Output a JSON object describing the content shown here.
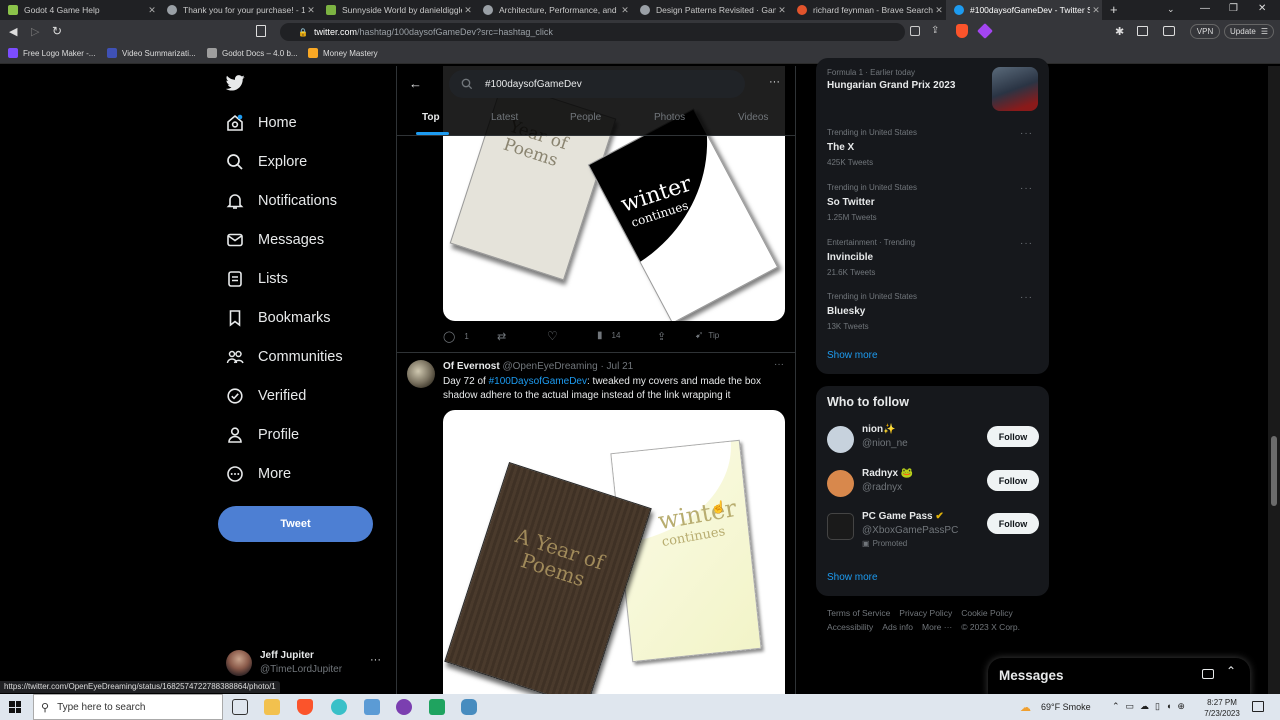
{
  "browser": {
    "tabs": [
      {
        "title": "Godot 4 Game Help",
        "color": "#8bc34a"
      },
      {
        "title": "Thank you for your purchase! - 1st Ph",
        "color": "#9aa0a6"
      },
      {
        "title": "Sunnyside World by danieldiggle",
        "color": "#7cb342"
      },
      {
        "title": "Architecture, Performance, and Game",
        "color": "#9aa0a6"
      },
      {
        "title": "Design Patterns Revisited · Game Pro",
        "color": "#9aa0a6"
      },
      {
        "title": "richard feynman - Brave Search",
        "color": "#e2542c"
      },
      {
        "title": "#100daysofGameDev - Twitter Se",
        "color": "#1d9bf0"
      }
    ],
    "url_host": "twitter.com",
    "url_path": "/hashtag/100daysofGameDev?src=hashtag_click",
    "vpn_label": "VPN",
    "update_label": "Update",
    "bookmarks": [
      {
        "label": "Free Logo Maker -...",
        "color": "#7c4dff"
      },
      {
        "label": "Video Summarizati...",
        "color": "#3f51b5"
      },
      {
        "label": "Godot Docs – 4.0 b...",
        "color": "#9e9e9e"
      },
      {
        "label": "Money Mastery",
        "color": "#f9a825"
      }
    ],
    "status_url": "https://twitter.com/OpenEyeDreaming/status/1682574722788388864/photo/1"
  },
  "nav": {
    "items": [
      {
        "label": "Home",
        "icon": "home-icon"
      },
      {
        "label": "Explore",
        "icon": "search-icon"
      },
      {
        "label": "Notifications",
        "icon": "bell-icon"
      },
      {
        "label": "Messages",
        "icon": "mail-icon"
      },
      {
        "label": "Lists",
        "icon": "list-icon"
      },
      {
        "label": "Bookmarks",
        "icon": "bookmark-icon"
      },
      {
        "label": "Communities",
        "icon": "people-icon"
      },
      {
        "label": "Verified",
        "icon": "verified-icon"
      },
      {
        "label": "Profile",
        "icon": "person-icon"
      },
      {
        "label": "More",
        "icon": "more-icon"
      }
    ],
    "tweet_label": "Tweet",
    "user_name": "Jeff Jupiter",
    "user_handle": "@TimeLordJupiter"
  },
  "search": {
    "query": "#100daysofGameDev",
    "tabs": [
      "Top",
      "Latest",
      "People",
      "Photos",
      "Videos"
    ]
  },
  "tweet1": {
    "image_text_a": [
      "Year of",
      "Poems"
    ],
    "image_text_b": [
      "winter",
      "continues"
    ],
    "replies": "1",
    "likes": "",
    "views": "14",
    "tip": "Tip"
  },
  "tweet2": {
    "author": "Of Evernost",
    "handle": "@OpenEyeDreaming",
    "date": "· Jul 21",
    "text_prefix": "Day 72 of ",
    "hashtag": "#100DaysofGameDev",
    "text_suffix": ": tweaked my covers and made the box shadow adhere to the actual image instead of the link wrapping it",
    "image_text_a": [
      "A Year of",
      "Poems"
    ],
    "image_text_b": [
      "winter",
      "continues"
    ]
  },
  "trends": {
    "top": {
      "meta": "Formula 1 · Earlier today",
      "name": "Hungarian Grand Prix 2023"
    },
    "items": [
      {
        "meta": "Trending in United States",
        "name": "The X",
        "count": "425K Tweets"
      },
      {
        "meta": "Trending in United States",
        "name": "So Twitter",
        "count": "1.25M Tweets"
      },
      {
        "meta": "Entertainment · Trending",
        "name": "Invincible",
        "count": "21.6K Tweets"
      },
      {
        "meta": "Trending in United States",
        "name": "Bluesky",
        "count": "13K Tweets"
      }
    ],
    "show_more": "Show more"
  },
  "who_to_follow": {
    "title": "Who to follow",
    "users": [
      {
        "name": "nion✨",
        "handle": "@nion_ne",
        "promoted": "",
        "avatar_color": "#c7d2dd"
      },
      {
        "name": "Radnyx 🐸",
        "handle": "@radnyx",
        "promoted": "",
        "avatar_color": "#d8884c"
      },
      {
        "name": "PC Game Pass",
        "handle": "@XboxGamePassPC",
        "promoted": "Promoted",
        "avatar_color": "#1a1a1a"
      }
    ],
    "follow_label": "Follow",
    "show_more": "Show more"
  },
  "footer": {
    "links": [
      "Terms of Service",
      "Privacy Policy",
      "Cookie Policy",
      "Accessibility",
      "Ads info",
      "More ···",
      "© 2023 X Corp."
    ]
  },
  "messages_dock": {
    "title": "Messages"
  },
  "taskbar": {
    "search_placeholder": "Type here to search",
    "weather": "69°F  Smoke",
    "time": "8:27 PM",
    "date": "7/23/2023"
  },
  "colors": {
    "accent": "#1d9bf0",
    "tweet_button": "#4d7fd3"
  }
}
